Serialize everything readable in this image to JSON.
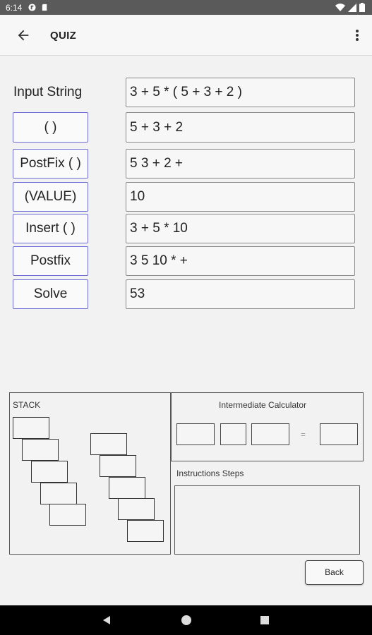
{
  "status_bar": {
    "time": "6:14"
  },
  "app_bar": {
    "title": "QUIZ"
  },
  "input_label": "Input String",
  "rows": [
    {
      "button": "( )",
      "value": "5 + 3 + 2"
    },
    {
      "button": "PostFix ( )",
      "value": "5 3 + 2 +"
    },
    {
      "button": "(VALUE)",
      "value": "10"
    },
    {
      "button": "Insert ( )",
      "value": "3 + 5 * 10"
    },
    {
      "button": "Postfix",
      "value": "3 5 10 * +"
    },
    {
      "button": "Solve",
      "value": "53"
    }
  ],
  "input_value": "3 + 5 * ( 5 + 3 + 2 )",
  "stack_panel": {
    "label": "STACK"
  },
  "calculator_panel": {
    "label": "Intermediate Calculator",
    "equals": "="
  },
  "instructions_panel": {
    "label": "Instructions Steps"
  },
  "back_button": "Back",
  "icons": {
    "back": "arrow-left-icon",
    "overflow": "more-vert-icon",
    "nav_back": "triangle-back-icon",
    "nav_home": "circle-home-icon",
    "nav_recent": "square-recent-icon"
  }
}
